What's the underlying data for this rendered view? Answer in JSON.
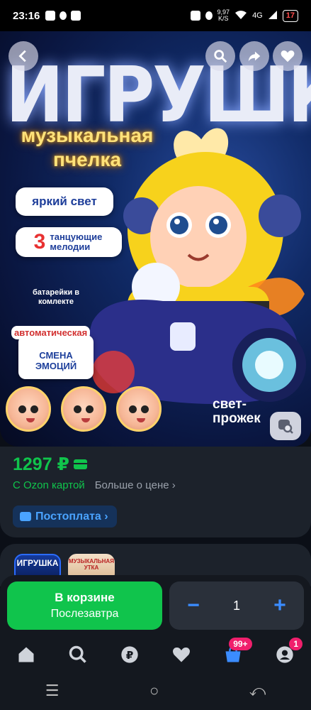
{
  "status_bar": {
    "time": "23:16",
    "speed_value": "9,97",
    "speed_unit": "K/S",
    "network": "4G",
    "battery": "17"
  },
  "hero": {
    "title": "ИГРУШКА",
    "subtitle": "музыкальная пчелка",
    "feature_light": "яркий свет",
    "feature_melodies_number": "3",
    "feature_melodies_text": "танцующие мелодии",
    "battery_note": "батарейки в комлекте",
    "auto_label": "автоматическая",
    "emotion_label": "СМЕНА ЭМОЦИЙ",
    "spotlight": "свет- прожек"
  },
  "price": {
    "value": "1297 ₽",
    "ozon_card": "С Ozon картой",
    "more_price": "Больше о цене ›"
  },
  "postpay": {
    "label": "Постоплата ›"
  },
  "thumbnails": [
    {
      "label": "ИГРУШКА"
    },
    {
      "label": "МУЗЫКАЛЬНАЯ УТКА"
    }
  ],
  "cart": {
    "line1": "В корзине",
    "line2": "Послезавтра",
    "minus": "−",
    "quantity": "1",
    "plus": "+"
  },
  "tabbar": {
    "items": [
      {
        "icon": "home-icon"
      },
      {
        "icon": "search-icon"
      },
      {
        "icon": "ruble-icon"
      },
      {
        "icon": "heart-icon"
      },
      {
        "icon": "cart-icon",
        "badge": "99+"
      },
      {
        "icon": "profile-icon",
        "badge": "1"
      }
    ]
  },
  "navbar": {
    "menu": "☰",
    "home": "○",
    "back": "⤺"
  },
  "colors": {
    "green": "#10c44c",
    "blue": "#3b8cff",
    "badge": "#f01f6c",
    "panel": "#1c222b"
  }
}
